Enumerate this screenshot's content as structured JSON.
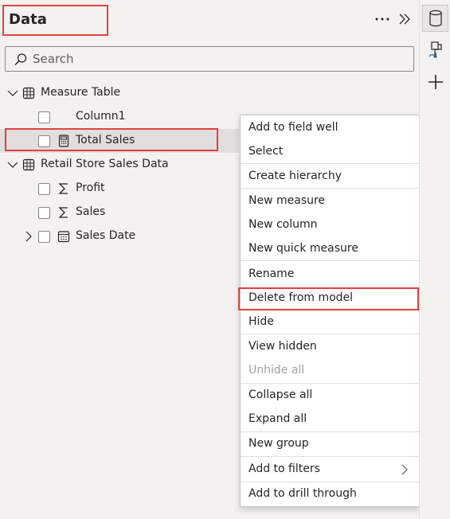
{
  "pane": {
    "title": "Data",
    "search_placeholder": "Search"
  },
  "tree": {
    "tables": [
      {
        "label": "Measure Table",
        "fields": [
          {
            "label": "Column1"
          },
          {
            "label": "Total Sales"
          }
        ]
      },
      {
        "label": "Retail Store Sales Data",
        "fields": [
          {
            "label": "Profit"
          },
          {
            "label": "Sales"
          },
          {
            "label": "Sales Date"
          }
        ]
      }
    ]
  },
  "context_menu": {
    "items": [
      {
        "label": "Add to field well"
      },
      {
        "label": "Select"
      },
      {
        "label": "Create hierarchy"
      },
      {
        "label": "New measure"
      },
      {
        "label": "New column"
      },
      {
        "label": "New quick measure"
      },
      {
        "label": "Rename"
      },
      {
        "label": "Delete from model"
      },
      {
        "label": "Hide"
      },
      {
        "label": "View hidden"
      },
      {
        "label": "Unhide all"
      },
      {
        "label": "Collapse all"
      },
      {
        "label": "Expand all"
      },
      {
        "label": "New group"
      },
      {
        "label": "Add to filters"
      },
      {
        "label": "Add to drill through"
      }
    ]
  },
  "colors": {
    "highlight_border": "#e0413f",
    "text": "#252423",
    "disabled_text": "#a19f9d",
    "accent_brush": "#2b88d8"
  },
  "icons": [
    "more-options-icon",
    "collapse-pane-icon",
    "search-icon",
    "table-icon",
    "calculator-icon",
    "sigma-icon",
    "calendar-icon",
    "database-icon",
    "format-brush-icon",
    "plus-icon"
  ]
}
